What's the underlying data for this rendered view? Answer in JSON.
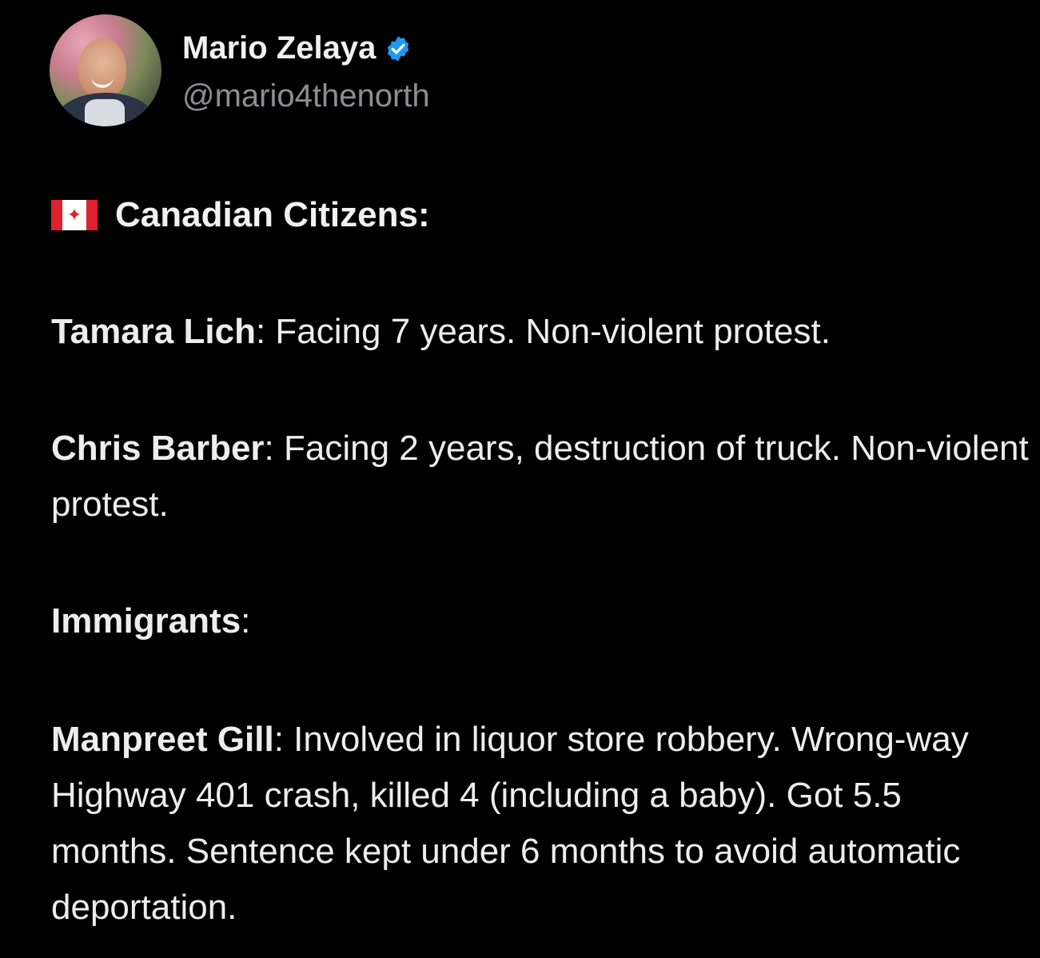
{
  "author": {
    "name": "Mario Zelaya",
    "handle": "@mario4thenorth",
    "verified_color": "#1d9bf0"
  },
  "post": {
    "flag_icon": "canada-flag-icon",
    "heading": "Canadian Citizens:",
    "entries": [
      {
        "name": "Tamara Lich",
        "text": ": Facing 7 years. Non-violent protest."
      },
      {
        "name": "Chris Barber",
        "text": ": Facing 2 years, destruction of truck. Non-violent protest."
      }
    ],
    "section2_heading": "Immigrants",
    "section2_colon": ":",
    "entries2": [
      {
        "name": "Manpreet Gill",
        "text": ": Involved in liquor store robbery. Wrong-way Highway 401 crash, killed 4 (including a baby). Got 5.5 months. Sentence kept under 6 months to avoid automatic deportation."
      }
    ]
  }
}
